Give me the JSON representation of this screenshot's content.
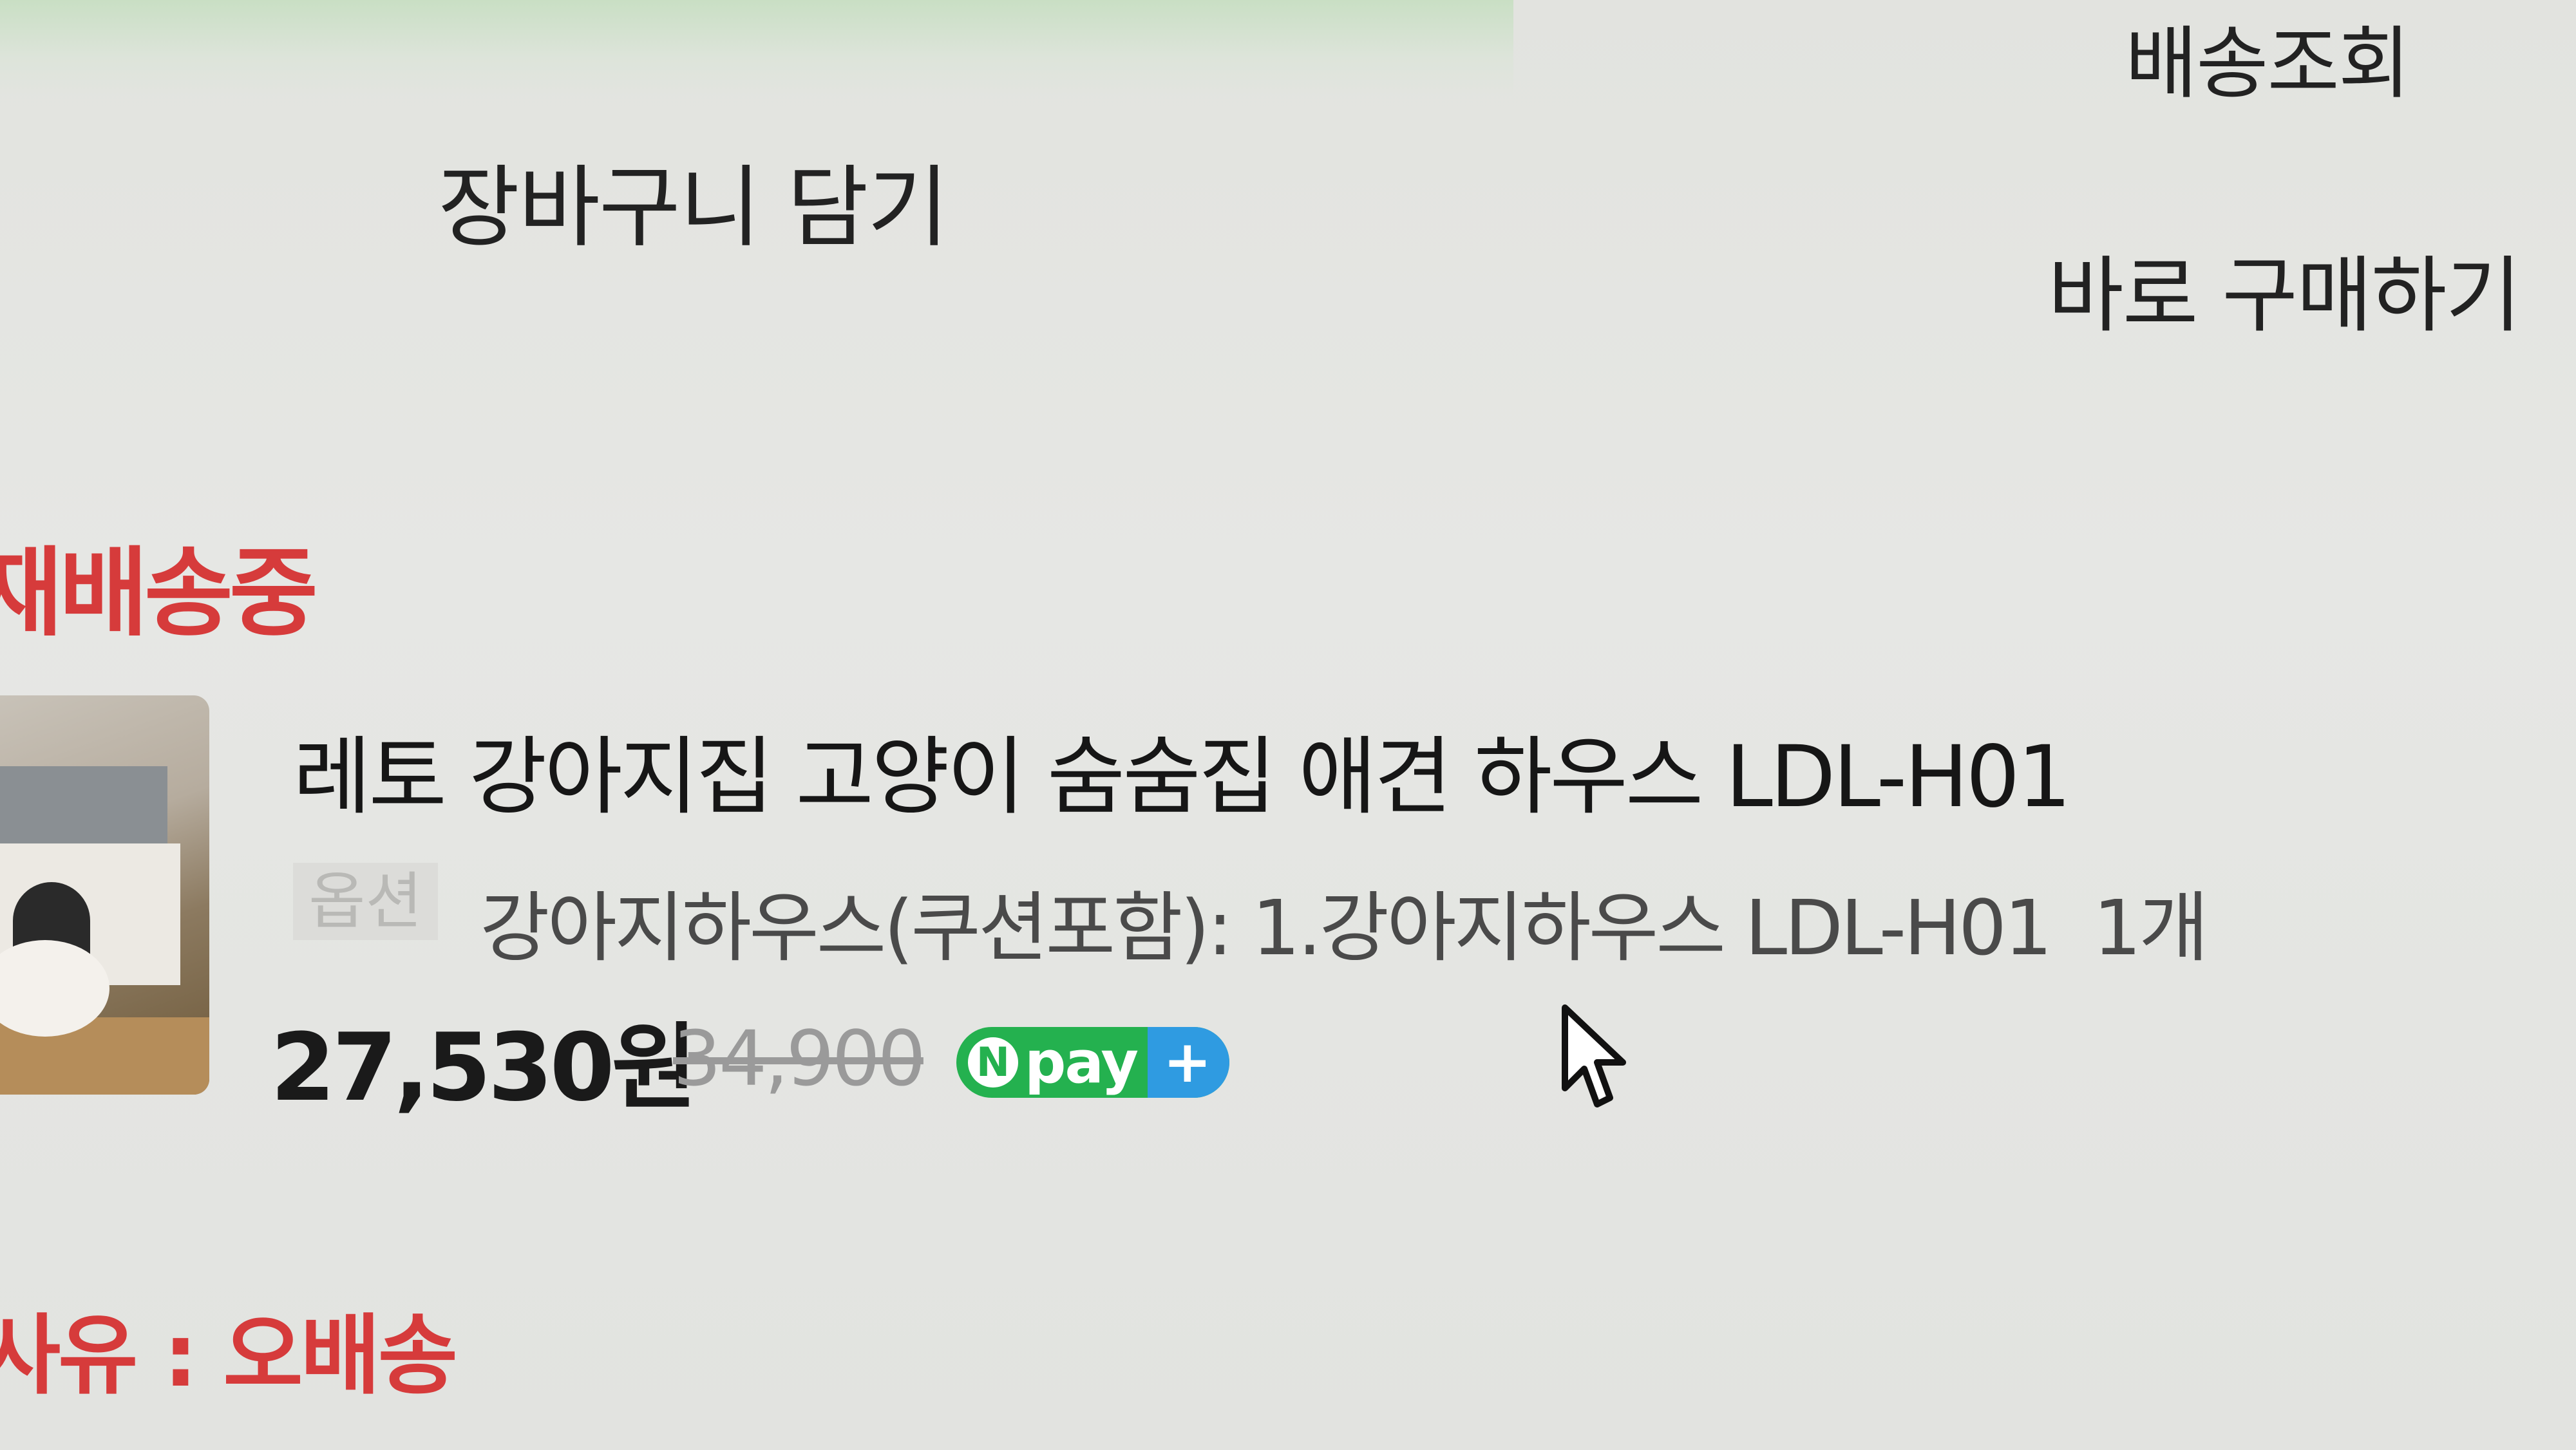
{
  "header": {
    "delivery_check": "배송조회",
    "add_to_cart": "장바구니 담기",
    "buy_now": "바로 구매하기"
  },
  "order": {
    "status": "재배송중",
    "product_name": "레토 강아지집 고양이 숨숨집 애견 하우스 LDL-H01",
    "option_label": "옵션",
    "option_value": "강아지하우스(쿠션포함): 1.강아지하우스 LDL-H01",
    "quantity": "1개",
    "price": "27,530원",
    "original_price": "34,900",
    "payment_badge": {
      "n": "N",
      "label": "pay",
      "plus": "+",
      "color_green": "#24b14f",
      "color_blue": "#2f9be1"
    },
    "reason": "사유 : 오배송"
  },
  "colors": {
    "status_red": "#d63b3b"
  },
  "icons": {
    "cursor": "mouse-pointer-icon"
  }
}
